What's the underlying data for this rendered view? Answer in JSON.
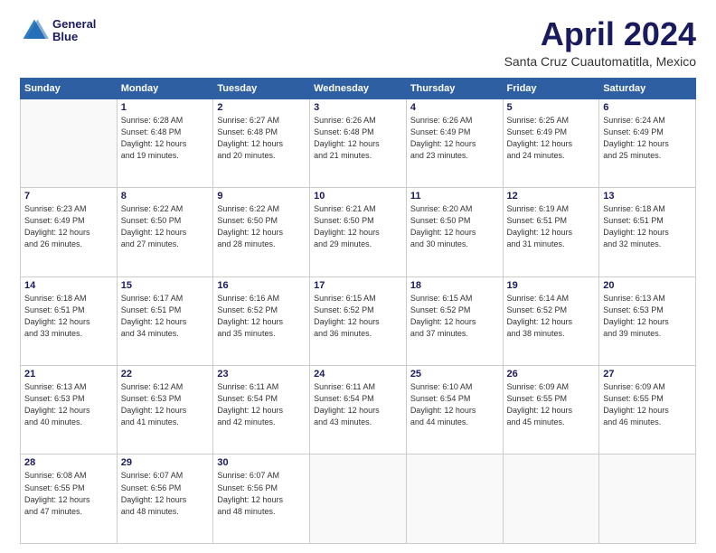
{
  "header": {
    "logo": {
      "line1": "General",
      "line2": "Blue"
    },
    "title": "April 2024",
    "subtitle": "Santa Cruz Cuautomatitla, Mexico"
  },
  "weekdays": [
    "Sunday",
    "Monday",
    "Tuesday",
    "Wednesday",
    "Thursday",
    "Friday",
    "Saturday"
  ],
  "weeks": [
    [
      {
        "day": "",
        "info": ""
      },
      {
        "day": "1",
        "info": "Sunrise: 6:28 AM\nSunset: 6:48 PM\nDaylight: 12 hours\nand 19 minutes."
      },
      {
        "day": "2",
        "info": "Sunrise: 6:27 AM\nSunset: 6:48 PM\nDaylight: 12 hours\nand 20 minutes."
      },
      {
        "day": "3",
        "info": "Sunrise: 6:26 AM\nSunset: 6:48 PM\nDaylight: 12 hours\nand 21 minutes."
      },
      {
        "day": "4",
        "info": "Sunrise: 6:26 AM\nSunset: 6:49 PM\nDaylight: 12 hours\nand 23 minutes."
      },
      {
        "day": "5",
        "info": "Sunrise: 6:25 AM\nSunset: 6:49 PM\nDaylight: 12 hours\nand 24 minutes."
      },
      {
        "day": "6",
        "info": "Sunrise: 6:24 AM\nSunset: 6:49 PM\nDaylight: 12 hours\nand 25 minutes."
      }
    ],
    [
      {
        "day": "7",
        "info": "Sunrise: 6:23 AM\nSunset: 6:49 PM\nDaylight: 12 hours\nand 26 minutes."
      },
      {
        "day": "8",
        "info": "Sunrise: 6:22 AM\nSunset: 6:50 PM\nDaylight: 12 hours\nand 27 minutes."
      },
      {
        "day": "9",
        "info": "Sunrise: 6:22 AM\nSunset: 6:50 PM\nDaylight: 12 hours\nand 28 minutes."
      },
      {
        "day": "10",
        "info": "Sunrise: 6:21 AM\nSunset: 6:50 PM\nDaylight: 12 hours\nand 29 minutes."
      },
      {
        "day": "11",
        "info": "Sunrise: 6:20 AM\nSunset: 6:50 PM\nDaylight: 12 hours\nand 30 minutes."
      },
      {
        "day": "12",
        "info": "Sunrise: 6:19 AM\nSunset: 6:51 PM\nDaylight: 12 hours\nand 31 minutes."
      },
      {
        "day": "13",
        "info": "Sunrise: 6:18 AM\nSunset: 6:51 PM\nDaylight: 12 hours\nand 32 minutes."
      }
    ],
    [
      {
        "day": "14",
        "info": "Sunrise: 6:18 AM\nSunset: 6:51 PM\nDaylight: 12 hours\nand 33 minutes."
      },
      {
        "day": "15",
        "info": "Sunrise: 6:17 AM\nSunset: 6:51 PM\nDaylight: 12 hours\nand 34 minutes."
      },
      {
        "day": "16",
        "info": "Sunrise: 6:16 AM\nSunset: 6:52 PM\nDaylight: 12 hours\nand 35 minutes."
      },
      {
        "day": "17",
        "info": "Sunrise: 6:15 AM\nSunset: 6:52 PM\nDaylight: 12 hours\nand 36 minutes."
      },
      {
        "day": "18",
        "info": "Sunrise: 6:15 AM\nSunset: 6:52 PM\nDaylight: 12 hours\nand 37 minutes."
      },
      {
        "day": "19",
        "info": "Sunrise: 6:14 AM\nSunset: 6:52 PM\nDaylight: 12 hours\nand 38 minutes."
      },
      {
        "day": "20",
        "info": "Sunrise: 6:13 AM\nSunset: 6:53 PM\nDaylight: 12 hours\nand 39 minutes."
      }
    ],
    [
      {
        "day": "21",
        "info": "Sunrise: 6:13 AM\nSunset: 6:53 PM\nDaylight: 12 hours\nand 40 minutes."
      },
      {
        "day": "22",
        "info": "Sunrise: 6:12 AM\nSunset: 6:53 PM\nDaylight: 12 hours\nand 41 minutes."
      },
      {
        "day": "23",
        "info": "Sunrise: 6:11 AM\nSunset: 6:54 PM\nDaylight: 12 hours\nand 42 minutes."
      },
      {
        "day": "24",
        "info": "Sunrise: 6:11 AM\nSunset: 6:54 PM\nDaylight: 12 hours\nand 43 minutes."
      },
      {
        "day": "25",
        "info": "Sunrise: 6:10 AM\nSunset: 6:54 PM\nDaylight: 12 hours\nand 44 minutes."
      },
      {
        "day": "26",
        "info": "Sunrise: 6:09 AM\nSunset: 6:55 PM\nDaylight: 12 hours\nand 45 minutes."
      },
      {
        "day": "27",
        "info": "Sunrise: 6:09 AM\nSunset: 6:55 PM\nDaylight: 12 hours\nand 46 minutes."
      }
    ],
    [
      {
        "day": "28",
        "info": "Sunrise: 6:08 AM\nSunset: 6:55 PM\nDaylight: 12 hours\nand 47 minutes."
      },
      {
        "day": "29",
        "info": "Sunrise: 6:07 AM\nSunset: 6:56 PM\nDaylight: 12 hours\nand 48 minutes."
      },
      {
        "day": "30",
        "info": "Sunrise: 6:07 AM\nSunset: 6:56 PM\nDaylight: 12 hours\nand 48 minutes."
      },
      {
        "day": "",
        "info": ""
      },
      {
        "day": "",
        "info": ""
      },
      {
        "day": "",
        "info": ""
      },
      {
        "day": "",
        "info": ""
      }
    ]
  ]
}
